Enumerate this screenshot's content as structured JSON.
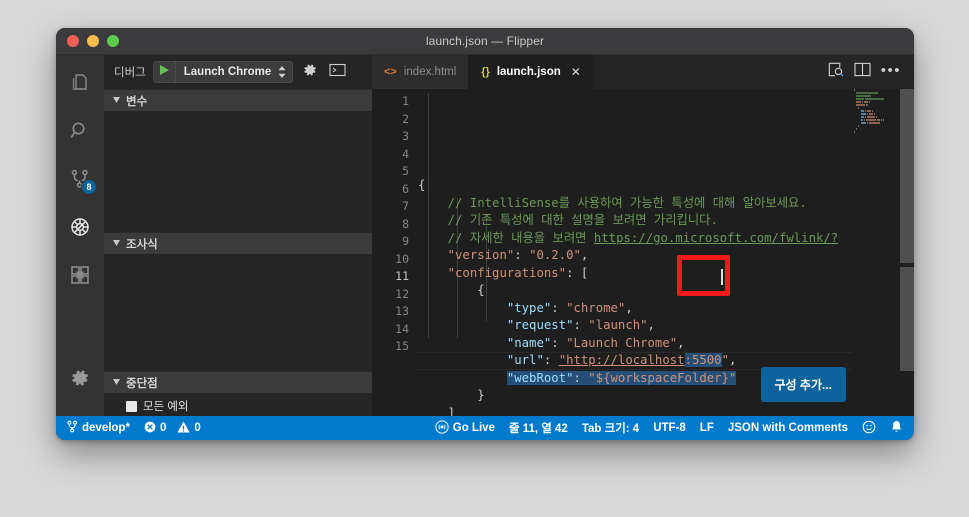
{
  "window": {
    "title": "launch.json — Flipper",
    "traffic_lights": [
      "close-button",
      "minimize-button",
      "maximize-button"
    ]
  },
  "activity_bar": {
    "items": [
      {
        "name": "explorer",
        "icon": "files-icon",
        "badge": ""
      },
      {
        "name": "search",
        "icon": "search-icon",
        "badge": ""
      },
      {
        "name": "source-control",
        "icon": "source-control-icon",
        "badge": "8"
      },
      {
        "name": "run-and-debug",
        "icon": "debug-icon",
        "badge": ""
      },
      {
        "name": "extensions",
        "icon": "extensions-icon",
        "badge": ""
      }
    ],
    "settings": {
      "name": "manage",
      "icon": "gear-icon"
    }
  },
  "debug_panel": {
    "toolbar": {
      "label": "디버그",
      "start_icon": "play-icon",
      "configuration": "Launch Chrome",
      "stepper_icon": "chevron-updown-icon",
      "settings_icon": "gear-icon",
      "console_icon": "terminal-icon"
    },
    "sections": [
      {
        "title": "변수",
        "chevron": "chevron-down-icon"
      },
      {
        "title": "조사식",
        "chevron": "chevron-down-icon"
      },
      {
        "title": "중단점",
        "chevron": "chevron-down-icon"
      }
    ],
    "breakpoints": [
      {
        "label": "모든 예외",
        "checked": false
      }
    ]
  },
  "tabs": [
    {
      "label": "index.html",
      "icon": "html-file-icon",
      "icon_glyph": "<>",
      "active": false,
      "closable": false
    },
    {
      "label": "launch.json",
      "icon": "json-file-icon",
      "icon_glyph": "{}",
      "active": true,
      "closable": true,
      "close_glyph": "✕"
    }
  ],
  "tab_actions": [
    {
      "name": "open-preview",
      "icon": "preview-magnifier-icon"
    },
    {
      "name": "split-editor",
      "icon": "split-editor-icon"
    },
    {
      "name": "more-actions",
      "icon": "ellipsis-icon",
      "glyph": "•••"
    }
  ],
  "editor": {
    "language": "JSON with Comments",
    "line_numbers": [
      "1",
      "2",
      "3",
      "4",
      "5",
      "6",
      "7",
      "8",
      "9",
      "10",
      "11",
      "12",
      "13",
      "14",
      "15"
    ],
    "current_line": 11,
    "lines": [
      {
        "n": 1,
        "indent": 0,
        "tokens": [
          {
            "t": "punct",
            "v": "{"
          }
        ]
      },
      {
        "n": 2,
        "indent": 1,
        "tokens": [
          {
            "t": "comment",
            "v": "// IntelliSense를 사용하여 가능한 특성에 대해 알아보세요."
          }
        ]
      },
      {
        "n": 3,
        "indent": 1,
        "tokens": [
          {
            "t": "comment",
            "v": "// 기존 특성에 대한 설명을 보려면 가리킵니다."
          }
        ]
      },
      {
        "n": 4,
        "indent": 1,
        "tokens": [
          {
            "t": "comment",
            "v": "// 자세한 내용을 보려면 "
          },
          {
            "t": "link",
            "v": "https://go.microsoft.com/fwlink/?"
          }
        ]
      },
      {
        "n": 5,
        "indent": 1,
        "tokens": [
          {
            "t": "string",
            "v": "\"version\""
          },
          {
            "t": "punct",
            "v": ": "
          },
          {
            "t": "string",
            "v": "\"0.2.0\""
          },
          {
            "t": "punct",
            "v": ","
          }
        ]
      },
      {
        "n": 6,
        "indent": 1,
        "tokens": [
          {
            "t": "string",
            "v": "\"configurations\""
          },
          {
            "t": "punct",
            "v": ": ["
          }
        ]
      },
      {
        "n": 7,
        "indent": 2,
        "tokens": [
          {
            "t": "punct",
            "v": "{"
          }
        ]
      },
      {
        "n": 8,
        "indent": 3,
        "tokens": [
          {
            "t": "key",
            "v": "\"type\""
          },
          {
            "t": "punct",
            "v": ": "
          },
          {
            "t": "string",
            "v": "\"chrome\""
          },
          {
            "t": "punct",
            "v": ","
          }
        ]
      },
      {
        "n": 9,
        "indent": 3,
        "tokens": [
          {
            "t": "key",
            "v": "\"request\""
          },
          {
            "t": "punct",
            "v": ": "
          },
          {
            "t": "string",
            "v": "\"launch\""
          },
          {
            "t": "punct",
            "v": ","
          }
        ]
      },
      {
        "n": 10,
        "indent": 3,
        "tokens": [
          {
            "t": "key",
            "v": "\"name\""
          },
          {
            "t": "punct",
            "v": ": "
          },
          {
            "t": "string",
            "v": "\"Launch Chrome\""
          },
          {
            "t": "punct",
            "v": ","
          }
        ]
      },
      {
        "n": 11,
        "indent": 3,
        "tokens": [
          {
            "t": "key",
            "v": "\"url\""
          },
          {
            "t": "punct",
            "v": ": "
          },
          {
            "t": "string-url",
            "v": "\"http://localhost"
          },
          {
            "t": "string-sel",
            "v": ":5500"
          },
          {
            "t": "string",
            "v": "\""
          },
          {
            "t": "punct",
            "v": ","
          }
        ]
      },
      {
        "n": 12,
        "indent": 3,
        "tokens": [
          {
            "t": "key-sel",
            "v": "\"webRoot\""
          },
          {
            "t": "punct-sel",
            "v": ": "
          },
          {
            "t": "string-sel",
            "v": "\"${workspaceFolder}\""
          }
        ]
      },
      {
        "n": 13,
        "indent": 2,
        "tokens": [
          {
            "t": "punct",
            "v": "}"
          }
        ]
      },
      {
        "n": 14,
        "indent": 1,
        "tokens": [
          {
            "t": "punct",
            "v": "]"
          }
        ]
      },
      {
        "n": 15,
        "indent": 0,
        "tokens": [
          {
            "t": "punct",
            "v": "}"
          }
        ]
      }
    ],
    "annotation": {
      "name": "port-highlight-box",
      "color": "#f41a1a",
      "target_text": ":5500"
    },
    "add_config_button": "구성 추가..."
  },
  "status_bar": {
    "branch": "develop*",
    "branch_icon": "source-control-icon",
    "errors_icon": "error-circle-icon",
    "errors": "0",
    "warnings_icon": "warning-triangle-icon",
    "warnings": "0",
    "go_live_icon": "broadcast-icon",
    "go_live": "Go Live",
    "cursor_position": "줄 11, 열 42",
    "indentation": "Tab 크기: 4",
    "encoding": "UTF-8",
    "eol": "LF",
    "language_mode": "JSON with Comments",
    "feedback_icon": "smiley-icon",
    "notifications_icon": "bell-icon"
  },
  "colors": {
    "accent": "#007acc",
    "button": "#0e639c",
    "annotation": "#f41a1a",
    "selection": "#264f78",
    "editor_bg": "#1e1e1e",
    "sidebar_bg": "#252526",
    "activitybar_bg": "#333333",
    "titlebar_bg": "#3b3b3d"
  }
}
